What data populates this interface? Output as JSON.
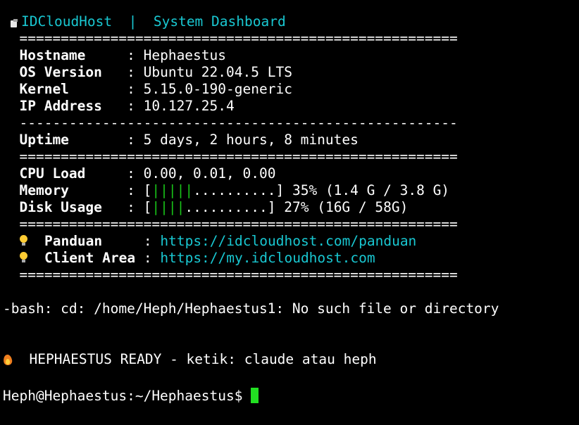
{
  "dashboard": {
    "title_icon": "server-icon",
    "brand": "IDCloudHost",
    "title_sep": "|",
    "title": "System Dashboard",
    "rule_double": "=====================================================",
    "rule_single": "-----------------------------------------------------",
    "colon": ":",
    "hostname_label": "Hostname",
    "hostname_value": "Hephaestus",
    "os_label": "OS Version",
    "os_value": "Ubuntu 22.04.5 LTS",
    "kernel_label": "Kernel",
    "kernel_value": "5.15.0-190-generic",
    "ip_label": "IP Address",
    "ip_value": "10.127.25.4",
    "uptime_label": "Uptime",
    "uptime_value": "5 days, 2 hours, 8 minutes",
    "cpu_label": "CPU Load",
    "cpu_value": "0.00, 0.01, 0.00",
    "memory_label": "Memory",
    "memory_bar_open": "[",
    "memory_bar_filled": "|||||",
    "memory_bar_empty": "..........",
    "memory_bar_close": "]",
    "memory_value": "35% (1.4 G / 3.8 G)",
    "disk_label": "Disk Usage",
    "disk_bar_open": "[",
    "disk_bar_filled": "||||",
    "disk_bar_empty": "..........",
    "disk_bar_close": "]",
    "disk_value": "27% (16G / 58G)",
    "panduan_label": "Panduan",
    "panduan_link": "https://idcloudhost.com/panduan",
    "client_label": "Client Area",
    "client_link": "https://my.idcloudhost.com",
    "link_icon": "lightbulb-icon"
  },
  "terminal": {
    "error_line": "-bash: cd: /home/Heph/Hephaestus1: No such file or directory",
    "ready_icon": "fire-icon",
    "ready_line": "HEPHAESTUS READY - ketik: claude atau heph",
    "prompt": "Heph@Hephaestus:~/Hephaestus$ "
  },
  "colors": {
    "background": "#000000",
    "foreground": "#ffffff",
    "accent_cyan": "#19c7d1",
    "bar_green": "#19c219",
    "cursor": "#22e022"
  }
}
